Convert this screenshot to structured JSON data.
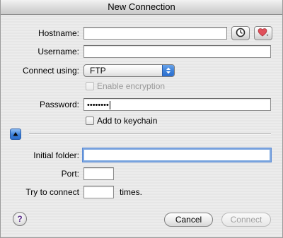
{
  "window": {
    "title": "New Connection"
  },
  "form": {
    "hostname_label": "Hostname:",
    "hostname_value": "",
    "username_label": "Username:",
    "username_value": "",
    "connect_using_label": "Connect using:",
    "connect_using_value": "FTP",
    "enable_encryption_label": "Enable encryption",
    "password_label": "Password:",
    "password_value": "••••••••",
    "add_to_keychain_label": "Add to keychain",
    "initial_folder_label": "Initial folder:",
    "initial_folder_value": "",
    "port_label": "Port:",
    "port_value": "",
    "try_to_connect_label": "Try to connect",
    "try_count_value": "",
    "times_label": "times."
  },
  "buttons": {
    "help_label": "?",
    "cancel_label": "Cancel",
    "connect_label": "Connect"
  },
  "icons": {
    "history": "clock-icon",
    "favorites": "heart-icon",
    "popup_arrows": "updown-arrows-icon",
    "disclosure": "disclosure-up-triangle-icon"
  },
  "colors": {
    "accent_blue": "#3b7fd8",
    "focus_ring": "#7fa8e0",
    "heart_red": "#e0505a"
  }
}
